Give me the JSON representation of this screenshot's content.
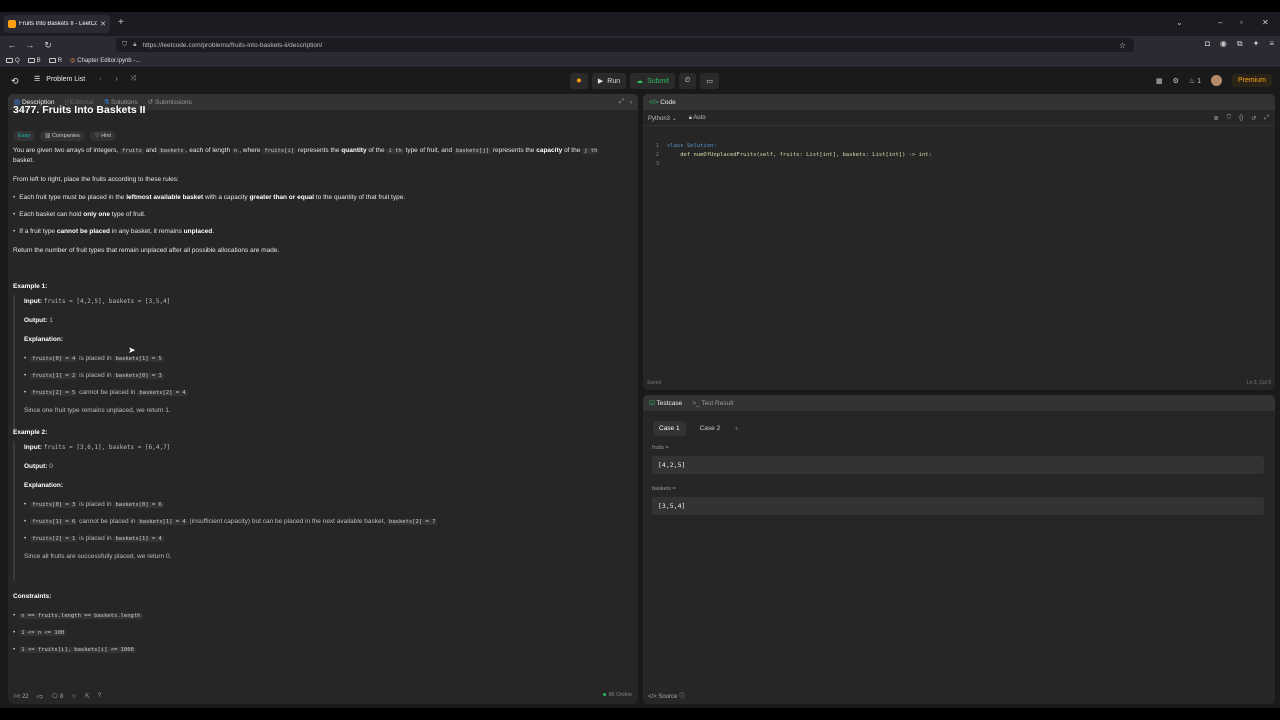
{
  "browser": {
    "tab_title": "Fruits Into Baskets II - LeetCode",
    "url": "https://leetcode.com/problems/fruits-into-baskets-ii/description/",
    "bookmarks": [
      "Q",
      "B",
      "R",
      "Chapter Editor.ipynb -..."
    ]
  },
  "topbar": {
    "problem_list": "Problem List",
    "run": "Run",
    "submit": "Submit",
    "streak": "1",
    "premium": "Premium"
  },
  "left_tabs": [
    "Description",
    "Editorial",
    "Solutions",
    "Submissions"
  ],
  "problem": {
    "title": "3477. Fruits Into Baskets II",
    "difficulty": "Easy",
    "companies": "Companies",
    "hint": "Hint",
    "intro": {
      "t1": "You are given two arrays of integers, ",
      "c1": "fruits",
      "t2": " and ",
      "c2": "baskets",
      "t3": ", each of length ",
      "c3": "n",
      "t4": ", where ",
      "c4": "fruits[i]",
      "t5": " represents the ",
      "b1": "quantity",
      "t6": " of the ",
      "c5": "i th",
      "t7": " type of fruit, and ",
      "c6": "baskets[j]",
      "t8": " represents the ",
      "b2": "capacity",
      "t9": " of the ",
      "c7": "j th",
      "t10": "basket."
    },
    "rules_intro": "From left to right, place the fruits according to these rules:",
    "rules": [
      {
        "a": "Each fruit type must be placed in the ",
        "b": "leftmost available basket",
        "c": " with a capacity ",
        "d": "greater than or equal",
        "e": " to the quantity of that fruit type."
      },
      {
        "a": "Each basket can hold ",
        "b": "only one",
        "c": " type of fruit.",
        "d": "",
        "e": ""
      },
      {
        "a": "If a fruit type ",
        "b": "cannot be placed",
        "c": " in any basket, it remains ",
        "d": "unplaced",
        "e": "."
      }
    ],
    "return_text": "Return the number of fruit types that remain unplaced after all possible allocations are made.",
    "example1": {
      "label": "Example 1:",
      "input_label": "Input:",
      "input": "fruits = [4,2,5], baskets = [3,5,4]",
      "output_label": "Output:",
      "output": "1",
      "explanation_label": "Explanation:",
      "lines": [
        {
          "c1": "fruits[0] = 4",
          "t": " is placed in ",
          "c2": "baskets[1] = 5",
          "t2": "",
          "c3": ""
        },
        {
          "c1": "fruits[1] = 2",
          "t": " is placed in ",
          "c2": "baskets[0] = 3",
          "t2": "",
          "c3": ""
        },
        {
          "c1": "fruits[2] = 5",
          "t": " cannot be placed in ",
          "c2": "baskets[2] = 4",
          "t2": "",
          "c3": ""
        }
      ],
      "conclusion": "Since one fruit type remains unplaced, we return 1."
    },
    "example2": {
      "label": "Example 2:",
      "input_label": "Input:",
      "input": "fruits = [3,6,1], baskets = [6,4,7]",
      "output_label": "Output:",
      "output": "0",
      "explanation_label": "Explanation:",
      "lines": [
        {
          "c1": "fruits[0] = 3",
          "t": " is placed in ",
          "c2": "baskets[0] = 6",
          "t2": "",
          "c3": ""
        },
        {
          "c1": "fruits[1] = 6",
          "t": " cannot be placed in ",
          "c2": "baskets[1] = 4",
          "t2": " (insufficient capacity) but can be placed in the next available basket, ",
          "c3": "baskets[2] = 7"
        },
        {
          "c1": "fruits[2] = 1",
          "t": " is placed in ",
          "c2": "baskets[1] = 4",
          "t2": "",
          "c3": ""
        }
      ],
      "conclusion": "Since all fruits are successfully placed, we return 0."
    },
    "constraints_label": "Constraints:",
    "constraints": [
      "n == fruits.length == baskets.length",
      "1 <= n <= 100",
      "1 <= fruits[i], baskets[i] <= 1000"
    ]
  },
  "footer": {
    "likes": "22",
    "comments": "8",
    "online": "96 Online"
  },
  "code_panel": {
    "tab": "Code",
    "language": "Python3",
    "mode": "Auto",
    "lines": [
      {
        "n": "1",
        "text": "class Solution:"
      },
      {
        "n": "2",
        "text": "    def numOfUnplacedFruits(self, fruits: List[int], baskets: List[int]) -> int:"
      },
      {
        "n": "3",
        "text": ""
      }
    ],
    "saved": "Saved",
    "cursor": "Ln 3, Col 9"
  },
  "test_panel": {
    "tab_testcase": "Testcase",
    "tab_result": "Test Result",
    "cases": [
      "Case 1",
      "Case 2"
    ],
    "fruits_label": "fruits =",
    "fruits_value": "[4,2,5]",
    "baskets_label": "baskets =",
    "baskets_value": "[3,5,4]",
    "source": "Source"
  }
}
